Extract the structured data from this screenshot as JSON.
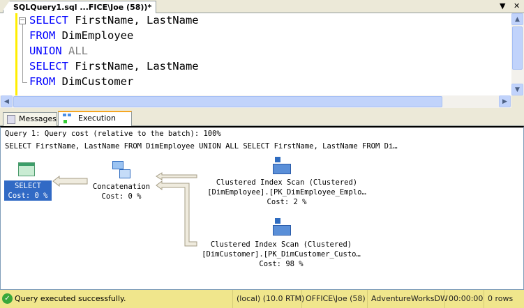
{
  "document_tab": {
    "title": "SQLQuery1.sql ...FICE\\Joe (58))*"
  },
  "window_controls": {
    "dropdown": "▼",
    "close": "✕"
  },
  "editor": {
    "lines": [
      {
        "kw": "SELECT",
        "rest": " FirstName, LastName"
      },
      {
        "kw": "FROM",
        "rest": " DimEmployee"
      },
      {
        "kw": "UNION",
        "gray": " ALL"
      },
      {
        "kw": "SELECT",
        "rest": " FirstName, LastName"
      },
      {
        "kw": "FROM",
        "rest": " DimCustomer"
      }
    ]
  },
  "results_tabs": [
    {
      "label": "Messages"
    },
    {
      "label": "Execution plan",
      "active": true
    }
  ],
  "plan": {
    "header": "Query 1: Query cost (relative to the batch): 100%",
    "statement": "SELECT FirstName, LastName FROM DimEmployee UNION ALL SELECT FirstName, LastName FROM Di…",
    "select_node": {
      "name": "SELECT",
      "cost": "Cost: 0 %"
    },
    "concat_node": {
      "name": "Concatenation",
      "cost": "Cost: 0 %"
    },
    "scan1": {
      "name": "Clustered Index Scan (Clustered)",
      "object": "[DimEmployee].[PK_DimEmployee_Emplo…",
      "cost": "Cost: 2 %"
    },
    "scan2": {
      "name": "Clustered Index Scan (Clustered)",
      "object": "[DimCustomer].[PK_DimCustomer_Custo…",
      "cost": "Cost: 98 %"
    }
  },
  "status": {
    "message": "Query executed successfully.",
    "server": "(local) (10.0 RTM)",
    "user": "OFFICE\\Joe (58)",
    "database": "AdventureWorksDW",
    "elapsed": "00:00:00",
    "rows": "0 rows"
  }
}
